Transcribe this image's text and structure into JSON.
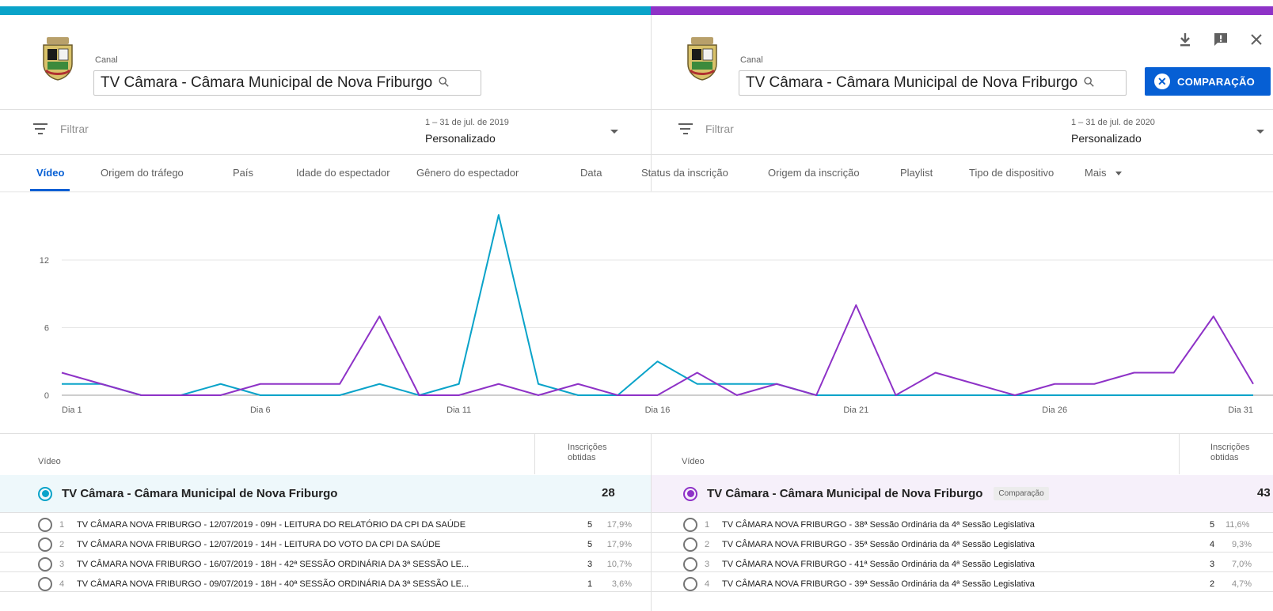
{
  "left": {
    "canal_label": "Canal",
    "channel": "TV Câmara - Câmara Municipal de Nova Friburgo",
    "filter_placeholder": "Filtrar",
    "date_range": "1 – 31 de jul. de 2019",
    "date_mode": "Personalizado",
    "table": {
      "col_video": "Vídeo",
      "col_metric": "Inscrições obtidas",
      "total_name": "TV Câmara - Câmara Municipal de Nova Friburgo",
      "total_value": "28",
      "rows": [
        {
          "n": "1",
          "title": "TV CÂMARA NOVA FRIBURGO - 12/07/2019 - 09H - LEITURA DO RELATÓRIO DA CPI DA SAÚDE",
          "value": "5",
          "pct": "17,9%"
        },
        {
          "n": "2",
          "title": "TV CÂMARA NOVA FRIBURGO - 12/07/2019 - 14H - LEITURA DO VOTO DA CPI DA SAÚDE",
          "value": "5",
          "pct": "17,9%"
        },
        {
          "n": "3",
          "title": "TV CÂMARA NOVA FRIBURGO - 16/07/2019 - 18H - 42ª SESSÃO ORDINÁRIA DA 3ª SESSÃO LE...",
          "value": "3",
          "pct": "10,7%"
        },
        {
          "n": "4",
          "title": "TV CÂMARA NOVA FRIBURGO - 09/07/2019 - 18H - 40ª SESSÃO ORDINÁRIA DA 3ª SESSÃO LE...",
          "value": "1",
          "pct": "3,6%"
        }
      ]
    }
  },
  "right": {
    "canal_label": "Canal",
    "channel": "TV Câmara - Câmara Municipal de Nova Friburgo",
    "filter_placeholder": "Filtrar",
    "date_range": "1 – 31 de jul. de 2020",
    "date_mode": "Personalizado",
    "compare_button": "COMPARAÇÃO",
    "table": {
      "col_video": "Vídeo",
      "col_metric": "Inscrições obtidas",
      "total_name": "TV Câmara - Câmara Municipal de Nova Friburgo",
      "badge": "Comparação",
      "total_value": "43",
      "rows": [
        {
          "n": "1",
          "title": "TV CÂMARA NOVA FRIBURGO - 38ª Sessão Ordinária da 4ª Sessão Legislativa",
          "value": "5",
          "pct": "11,6%"
        },
        {
          "n": "2",
          "title": "TV CÂMARA NOVA FRIBURGO - 35ª Sessão Ordinária da 4ª Sessão Legislativa",
          "value": "4",
          "pct": "9,3%"
        },
        {
          "n": "3",
          "title": "TV CÂMARA NOVA FRIBURGO - 41ª Sessão Ordinária da 4ª Sessão Legislativa",
          "value": "3",
          "pct": "7,0%"
        },
        {
          "n": "4",
          "title": "TV CÂMARA NOVA FRIBURGO - 39ª Sessão Ordinária da 4ª Sessão Legislativa",
          "value": "2",
          "pct": "4,7%"
        }
      ]
    }
  },
  "toolbar_icons": [
    "download-icon",
    "feedback-icon",
    "close-icon"
  ],
  "tabs": [
    {
      "label": "Vídeo",
      "active": true
    },
    {
      "label": "Origem do tráfego"
    },
    {
      "label": "País"
    },
    {
      "label": "Idade do espectador"
    },
    {
      "label": "Gênero do espectador"
    },
    {
      "label": "Data"
    },
    {
      "label": "Status da inscrição"
    },
    {
      "label": "Origem da inscrição"
    },
    {
      "label": "Playlist"
    },
    {
      "label": "Tipo de dispositivo"
    },
    {
      "label": "Mais"
    }
  ],
  "colors": {
    "series_2019": "#0aa3c9",
    "series_2020": "#8e32c7",
    "accent": "#065fd4"
  },
  "chart_data": {
    "type": "line",
    "x": [
      1,
      2,
      3,
      4,
      5,
      6,
      7,
      8,
      9,
      10,
      11,
      12,
      13,
      14,
      15,
      16,
      17,
      18,
      19,
      20,
      21,
      22,
      23,
      24,
      25,
      26,
      27,
      28,
      29,
      30,
      31
    ],
    "x_ticks": [
      "Dia 1",
      "Dia 6",
      "Dia 11",
      "Dia 16",
      "Dia 21",
      "Dia 26",
      "Dia 31"
    ],
    "y_ticks": [
      "0",
      "6",
      "12"
    ],
    "ylim": [
      0,
      16
    ],
    "grid": true,
    "series": [
      {
        "color": "#0aa3c9",
        "values": [
          1,
          1,
          0,
          0,
          1,
          0,
          0,
          0,
          1,
          0,
          1,
          16,
          1,
          0,
          0,
          3,
          1,
          1,
          1,
          0,
          0,
          0,
          0,
          0,
          0,
          0,
          0,
          0,
          0,
          0,
          0
        ]
      },
      {
        "color": "#8e32c7",
        "values": [
          2,
          1,
          0,
          0,
          0,
          1,
          1,
          1,
          7,
          0,
          0,
          1,
          0,
          1,
          0,
          0,
          2,
          0,
          1,
          0,
          8,
          0,
          2,
          1,
          0,
          1,
          1,
          2,
          2,
          7,
          1
        ]
      }
    ]
  }
}
